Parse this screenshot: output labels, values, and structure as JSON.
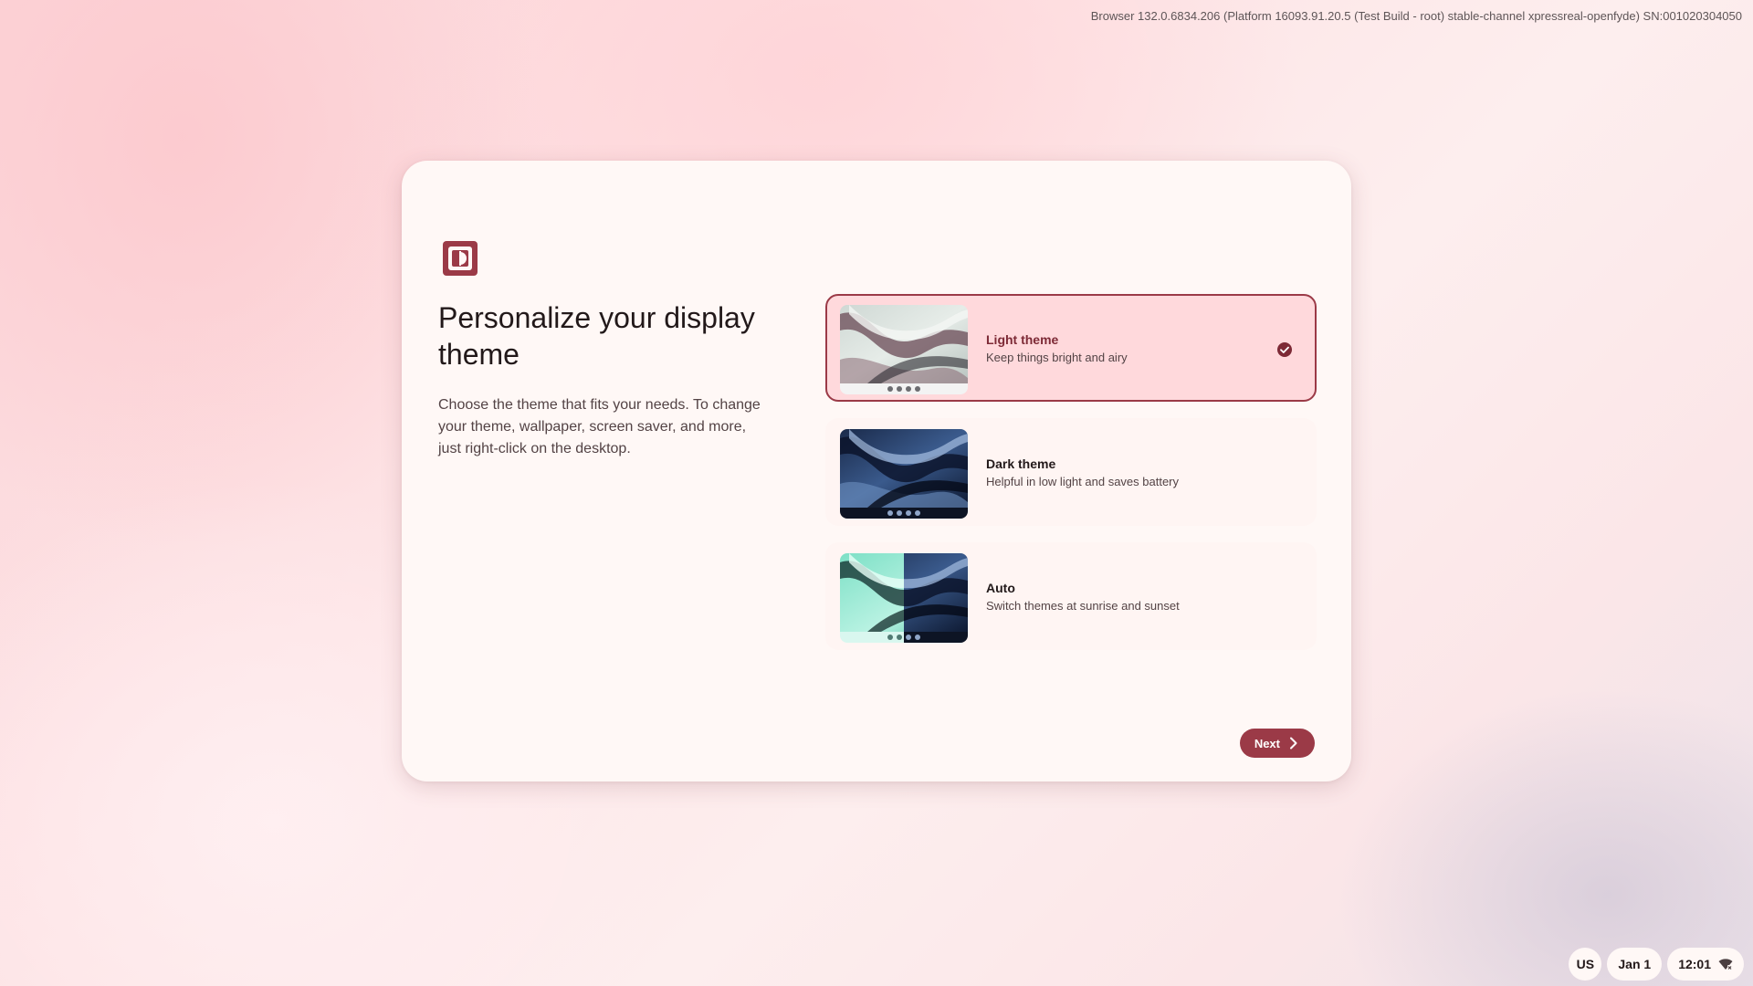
{
  "system": {
    "build_info": "Browser 132.0.6834.206 (Platform 16093.91.20.5 (Test Build - root) stable-channel xpressreal-openfyde) SN:001020304050"
  },
  "dialog": {
    "icon": "theme-icon",
    "title": "Personalize your display theme",
    "description": "Choose the theme that fits your needs. To change your theme, wallpaper, screen saver, and more, just right-click on the desktop.",
    "options": [
      {
        "title": "Light theme",
        "subtitle": "Keep things bright and airy",
        "selected": true
      },
      {
        "title": "Dark theme",
        "subtitle": "Helpful in low light and saves battery",
        "selected": false
      },
      {
        "title": "Auto",
        "subtitle": "Switch themes at sunrise and sunset",
        "selected": false
      }
    ],
    "next_label": "Next"
  },
  "shelf": {
    "keyboard_layout": "US",
    "date": "Jan 1",
    "time": "12:01"
  },
  "colors": {
    "accent": "#9b3a47",
    "selected_bg": "#ffd9dc",
    "dialog_bg": "#fff8f6"
  }
}
